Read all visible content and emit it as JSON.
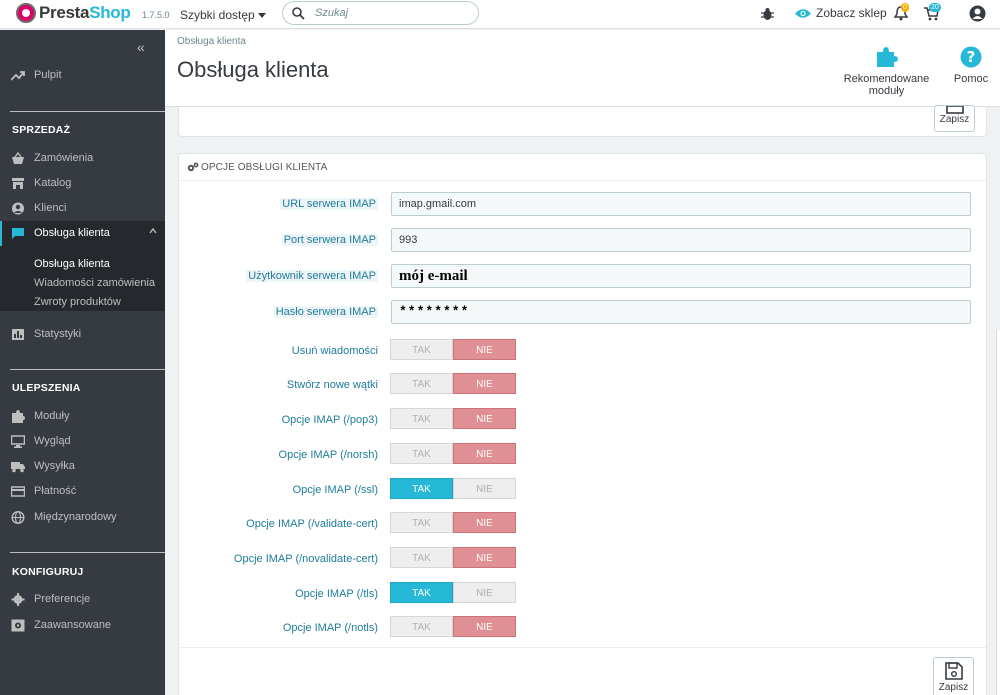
{
  "topbar": {
    "logo_text_part1": "Presta",
    "logo_text_part2": "Shop",
    "version": "1.7.5.0",
    "quick_access": "Szybki dostęp",
    "search_placeholder": "Szukaj",
    "view_shop": "Zobacz sklep",
    "notifications_count": "0",
    "orders_count": "20",
    "accent_color": "#25b9d7"
  },
  "sidebar": {
    "dashboard": "Pulpit",
    "sections": {
      "sell": "SPRZEDAŻ",
      "improve": "ULEPSZENIA",
      "configure": "KONFIGURUJ"
    },
    "sell_items": [
      "Zamówienia",
      "Katalog",
      "Klienci",
      "Obsługa klienta"
    ],
    "sub_items": [
      "Obsługa klienta",
      "Wiadomości zamówienia",
      "Zwroty produktów"
    ],
    "stats": "Statystyki",
    "improve_items": [
      "Moduły",
      "Wygląd",
      "Wysyłka",
      "Płatność",
      "Międzynarodowy"
    ],
    "configure_items": [
      "Preferencje",
      "Zaawansowane"
    ]
  },
  "header": {
    "breadcrumb": "Obsługa klienta",
    "title": "Obsługa klienta",
    "recommended_modules": "Rekomendowane moduły",
    "help": "Pomoc"
  },
  "save_label": "Zapisz",
  "panel": {
    "heading": "OPCJE OBSŁUGI KLIENTA",
    "fields": [
      {
        "label": "URL serwera IMAP",
        "value": "imap.gmail.com"
      },
      {
        "label": "Port serwera IMAP",
        "value": "993"
      },
      {
        "label": "Użytkownik serwera IMAP",
        "value": "mój e-mail"
      },
      {
        "label": "Hasło serwera IMAP",
        "value": "********"
      }
    ],
    "yes_label": "TAK",
    "no_label": "NIE",
    "switches": [
      {
        "label": "Usuń wiadomości",
        "value": "NIE"
      },
      {
        "label": "Stwórz nowe wątki",
        "value": "NIE"
      },
      {
        "label": "Opcje IMAP (/pop3)",
        "value": "NIE"
      },
      {
        "label": "Opcje IMAP (/norsh)",
        "value": "NIE"
      },
      {
        "label": "Opcje IMAP (/ssl)",
        "value": "TAK"
      },
      {
        "label": "Opcje IMAP (/validate-cert)",
        "value": "NIE"
      },
      {
        "label": "Opcje IMAP (/novalidate-cert)",
        "value": "NIE"
      },
      {
        "label": "Opcje IMAP (/tls)",
        "value": "TAK"
      },
      {
        "label": "Opcje IMAP (/notls)",
        "value": "NIE"
      }
    ]
  }
}
